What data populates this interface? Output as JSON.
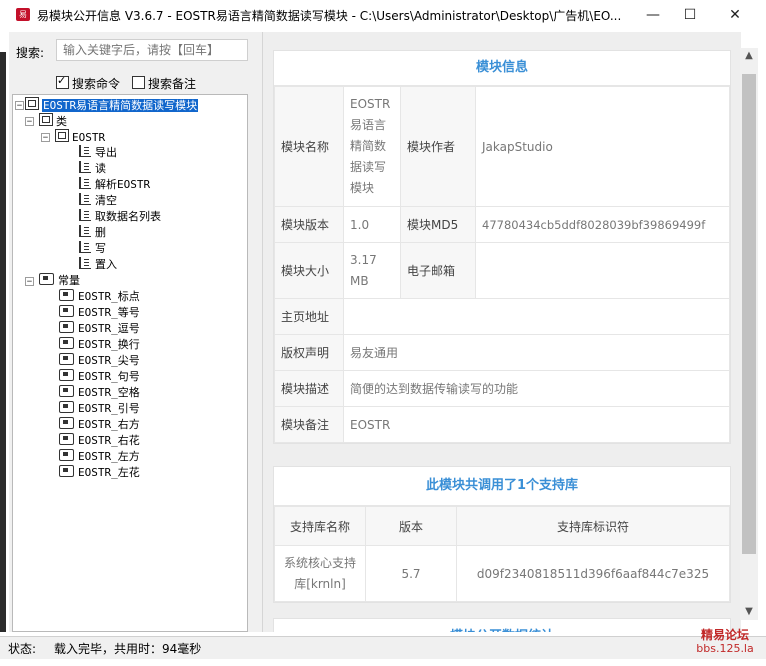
{
  "window": {
    "title": "易模块公开信息 V3.6.7 - EOSTR易语言精简数据读写模块 - C:\\Users\\Administrator\\Desktop\\广告机\\EO...",
    "app_icon_text": "易",
    "minimize": "—",
    "maximize": "☐",
    "close": "✕"
  },
  "search": {
    "label": "搜索:",
    "placeholder": "输入关键字后，请按【回车】",
    "option_commands": "搜索命令",
    "option_commands_checked": true,
    "option_notes": "搜索备注",
    "option_notes_checked": false
  },
  "tree": {
    "root": "EOSTR易语言精简数据读写模块",
    "classes": "类",
    "class_name": "EOSTR",
    "methods": [
      "导出",
      "读",
      "解析EOSTR",
      "清空",
      "取数据名列表",
      "删",
      "写",
      "置入"
    ],
    "constants_label": "常量",
    "constants": [
      "EOSTR_标点",
      "EOSTR_等号",
      "EOSTR_逗号",
      "EOSTR_换行",
      "EOSTR_尖号",
      "EOSTR_句号",
      "EOSTR_空格",
      "EOSTR_引号",
      "EOSTR_右方",
      "EOSTR_右花",
      "EOSTR_左方",
      "EOSTR_左花"
    ]
  },
  "module_info": {
    "title": "模块信息",
    "name_label": "模块名称",
    "name_value": "EOSTR易语言精简数据读写模块",
    "author_label": "模块作者",
    "author_value": "JakapStudio",
    "version_label": "模块版本",
    "version_value": "1.0",
    "md5_label": "模块MD5",
    "md5_value": "47780434cb5ddf8028039bf39869499f",
    "size_label": "模块大小",
    "size_value": "3.17 MB",
    "email_label": "电子邮箱",
    "email_value": "",
    "homepage_label": "主页地址",
    "homepage_value": "",
    "copyright_label": "版权声明",
    "copyright_value": "易友通用",
    "desc_label": "模块描述",
    "desc_value": "简便的达到数据传输读写的功能",
    "note_label": "模块备注",
    "note_value": "EOSTR"
  },
  "support": {
    "title": "此模块共调用了1个支持库",
    "col_name": "支持库名称",
    "col_version": "版本",
    "col_id": "支持库标识符",
    "rows": [
      {
        "name": "系统核心支持库[krnln]",
        "version": "5.7",
        "id": "d09f2340818511d396f6aaf844c7e325"
      }
    ]
  },
  "next_section_title": "模块公开数据统计",
  "status": {
    "label": "状态:",
    "text": "载入完毕，共用时：94毫秒"
  },
  "watermark": {
    "line1": "精易论坛",
    "line2": "bbs.125.la"
  }
}
